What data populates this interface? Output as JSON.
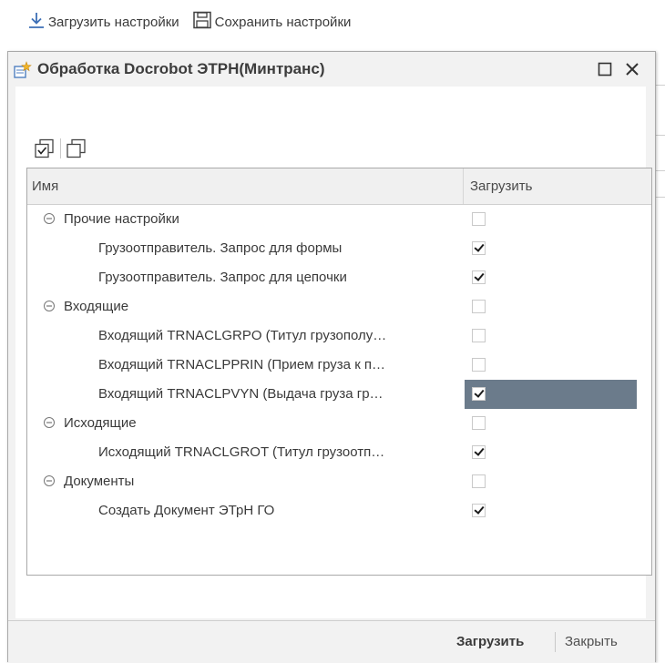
{
  "toolbar": {
    "load_settings": "Загрузить настройки",
    "save_settings": "Сохранить настройки"
  },
  "dialog": {
    "title": "Обработка  Docrobot ЭТРН(Минтранс)"
  },
  "table": {
    "col_name": "Имя",
    "col_load": "Загрузить",
    "rows": [
      {
        "label": "Прочие настройки",
        "level": 0,
        "group": true,
        "checked": false
      },
      {
        "label": "Грузоотправитель. Запрос для формы",
        "level": 1,
        "group": false,
        "checked": true
      },
      {
        "label": "Грузоотправитель. Запрос для цепочки",
        "level": 1,
        "group": false,
        "checked": true
      },
      {
        "label": "Входящие",
        "level": 0,
        "group": true,
        "checked": false
      },
      {
        "label": "Входящий TRNACLGRPO (Титул грузополу…",
        "level": 1,
        "group": false,
        "checked": false
      },
      {
        "label": "Входящий TRNACLPPRIN (Прием груза к п…",
        "level": 1,
        "group": false,
        "checked": false
      },
      {
        "label": "Входящий TRNACLPVYN (Выдача груза гр…",
        "level": 1,
        "group": false,
        "checked": true,
        "selected": true
      },
      {
        "label": "Исходящие",
        "level": 0,
        "group": true,
        "checked": false
      },
      {
        "label": "Исходящий TRNACLGROT (Титул грузоотп…",
        "level": 1,
        "group": false,
        "checked": true
      },
      {
        "label": "Документы",
        "level": 0,
        "group": true,
        "checked": false
      },
      {
        "label": "Создать Документ ЭТрН ГО",
        "level": 1,
        "group": false,
        "checked": true
      }
    ]
  },
  "footer": {
    "load_button": "Загрузить",
    "close_button": "Закрыть"
  },
  "colors": {
    "selection": "#6b7b8b",
    "dialog_bg": "#f2f2f2"
  }
}
